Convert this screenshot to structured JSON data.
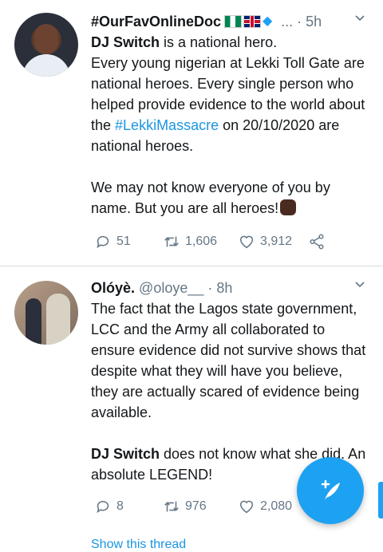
{
  "tweets": [
    {
      "name": "#OurFavOnlineDoc",
      "ellipsis": "...",
      "dot": "·",
      "time": "5h",
      "body": {
        "l1_bold": "DJ Switch",
        "l1_rest": " is a national hero.",
        "l2": "Every young nigerian at Lekki Toll Gate are national heroes. Every single person who helped provide evidence to the world about the ",
        "hashtag": "#LekkiMassacre",
        "l2_end": " on 20/10/2020 are national heroes.",
        "l3": "We may not know everyone of you by name. But you are all heroes!"
      },
      "replies": "51",
      "retweets": "1,606",
      "likes": "3,912"
    },
    {
      "name": "Olóyè.",
      "handle": "@oloye__",
      "dot": "·",
      "time": "8h",
      "body": {
        "p1": "The fact that the Lagos state government, LCC and the Army all collaborated to ensure evidence did not survive shows that despite what they will have you believe, they are actually scared of evidence being available.",
        "p2_bold": "DJ Switch",
        "p2_rest": " does not know what she did. An absolute LEGEND!"
      },
      "replies": "8",
      "retweets": "976",
      "likes": "2,080"
    }
  ],
  "show_thread": "Show this thread",
  "colors": {
    "accent": "#1da1f2",
    "link": "#1b95e0",
    "muted": "#657786"
  },
  "icons": [
    "reply-icon",
    "retweet-icon",
    "like-icon",
    "share-icon",
    "chevron-down-icon",
    "compose-icon"
  ]
}
